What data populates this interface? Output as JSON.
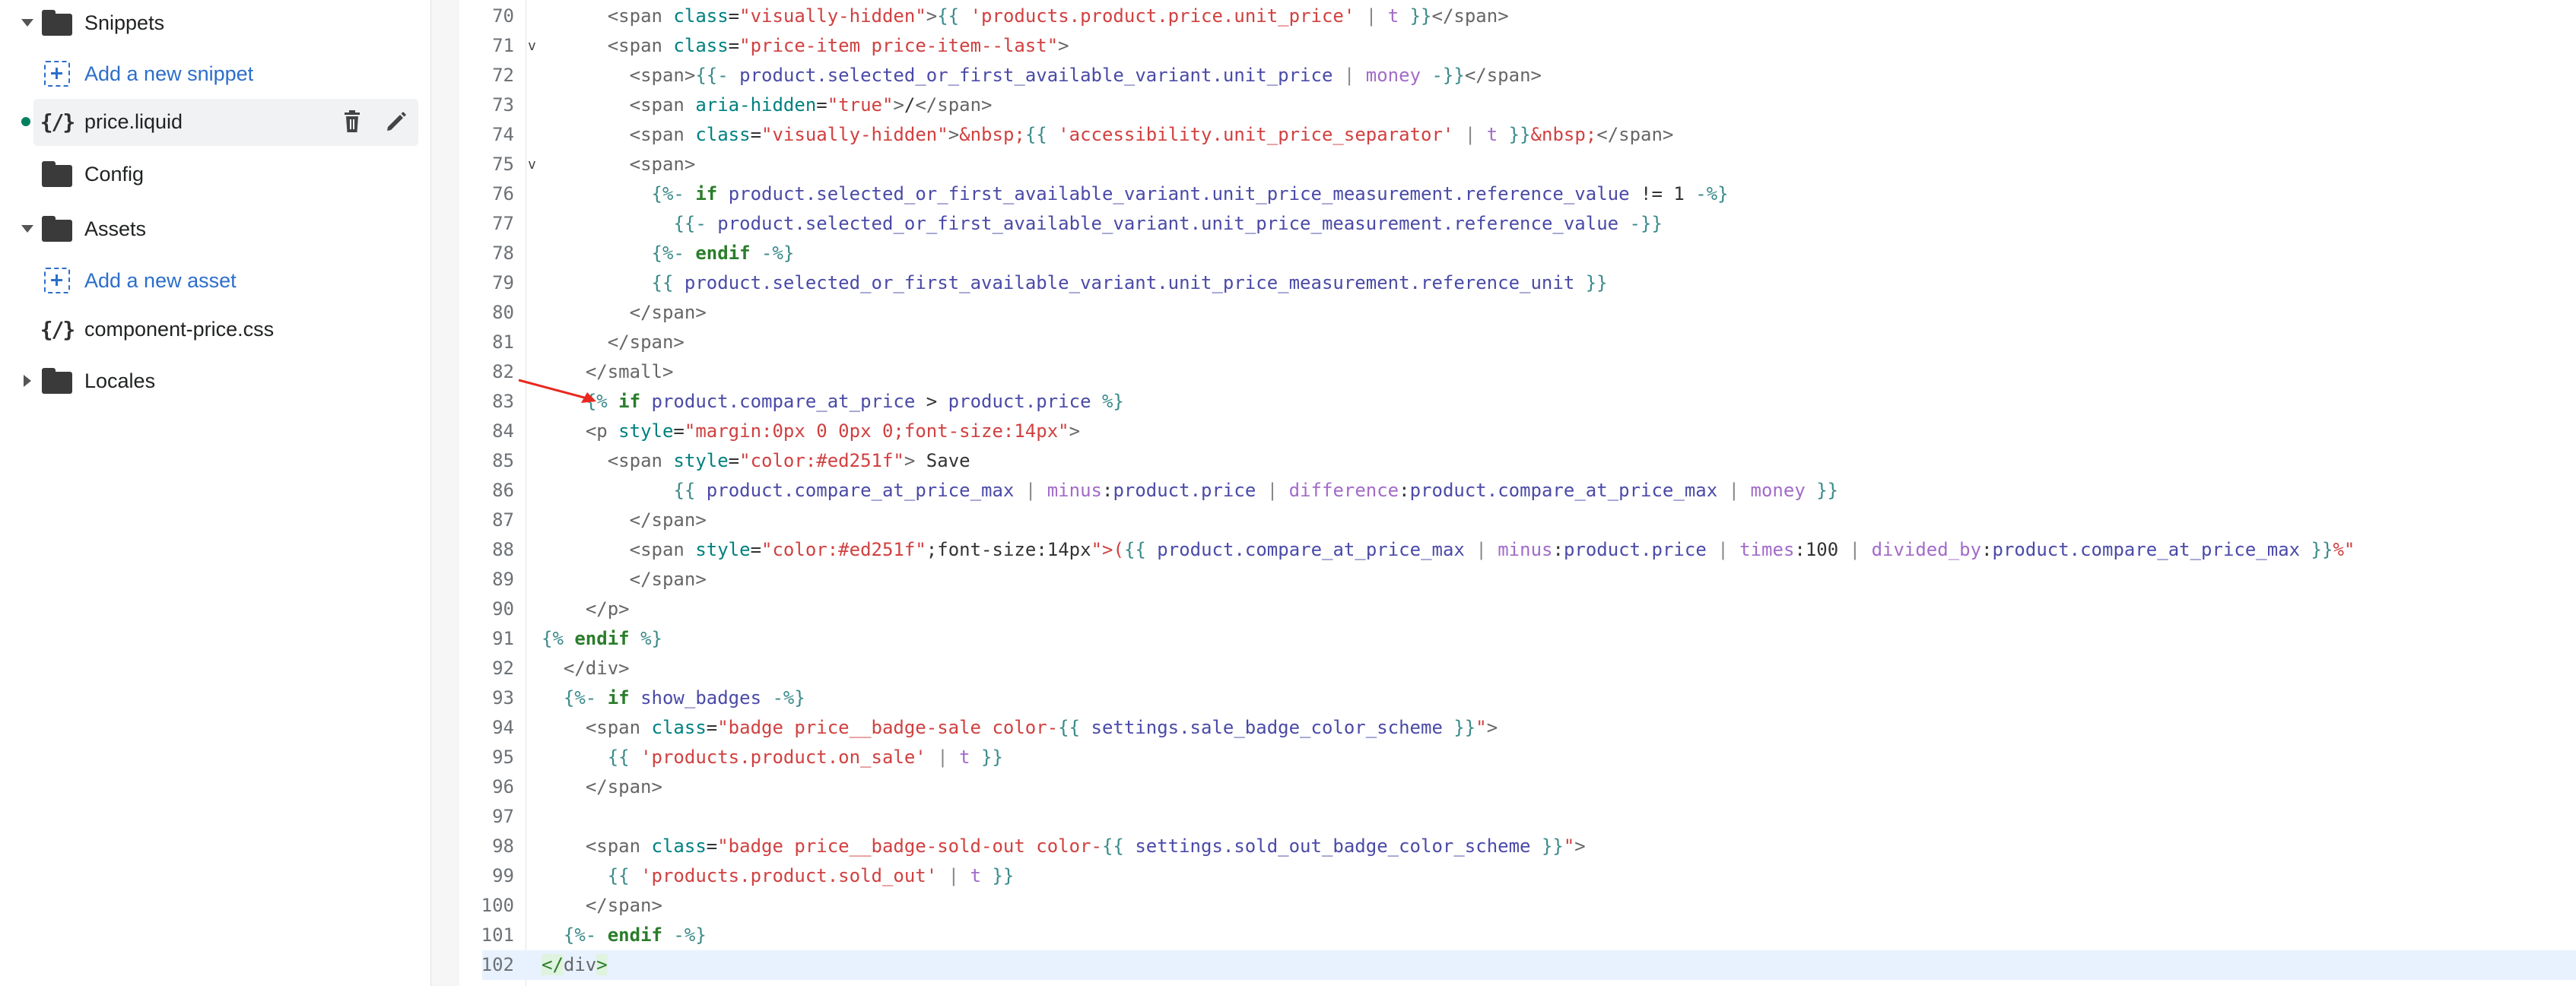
{
  "sidebar": {
    "items": [
      {
        "label": "Snippets",
        "type": "folder",
        "expanded": true
      },
      {
        "label": "Add a new snippet",
        "type": "add"
      },
      {
        "label": "price.liquid",
        "type": "file",
        "selected": true,
        "modified": true
      },
      {
        "label": "Config",
        "type": "folder"
      },
      {
        "label": "Assets",
        "type": "folder",
        "expanded": true
      },
      {
        "label": "Add a new asset",
        "type": "add"
      },
      {
        "label": "component-price.css",
        "type": "file"
      },
      {
        "label": "Locales",
        "type": "folder",
        "expanded": false
      }
    ],
    "actions": {
      "delete_icon": "trash-icon",
      "edit_icon": "pencil-icon"
    }
  },
  "editor": {
    "active_line": 102,
    "line_numbers": [
      "70",
      "71",
      "72",
      "73",
      "74",
      "75",
      "76",
      "77",
      "78",
      "79",
      "80",
      "81",
      "82",
      "83",
      "84",
      "85",
      "86",
      "87",
      "88",
      "89",
      "90",
      "91",
      "92",
      "93",
      "94",
      "95",
      "96",
      "97",
      "98",
      "99",
      "100",
      "101",
      "102"
    ],
    "folds": {
      "71": "v",
      "75": "v"
    },
    "lines": [
      "      <span class=\"visually-hidden\">{{ 'products.product.price.unit_price' | t }}</span>",
      "      <span class=\"price-item price-item--last\">",
      "        <span>{{- product.selected_or_first_available_variant.unit_price | money -}}</span>",
      "        <span aria-hidden=\"true\">/</span>",
      "        <span class=\"visually-hidden\">&nbsp;{{ 'accessibility.unit_price_separator' | t }}&nbsp;</span>",
      "        <span>",
      "          {%- if product.selected_or_first_available_variant.unit_price_measurement.reference_value != 1 -%}",
      "            {{- product.selected_or_first_available_variant.unit_price_measurement.reference_value -}}",
      "          {%- endif -%}",
      "          {{ product.selected_or_first_available_variant.unit_price_measurement.reference_unit }}",
      "        </span>",
      "      </span>",
      "    </small>",
      "    {% if product.compare_at_price > product.price %}",
      "    <p style=\"margin:0px 0 0px 0;font-size:14px\">",
      "      <span style=\"color:#ed251f\"> Save",
      "            {{ product.compare_at_price_max | minus:product.price | difference:product.compare_at_price_max | money }}",
      "        </span>",
      "        <span style=\"color:#ed251f\";font-size:14px\">({{ product.compare_at_price_max | minus:product.price | times:100 | divided_by:product.compare_at_price_max }}%)",
      "        </span>",
      "    </p>",
      "{% endif %}",
      "  </div>",
      "  {%- if show_badges -%}",
      "    <span class=\"badge price__badge-sale color-{{ settings.sale_badge_color_scheme }}\">",
      "      {{ 'products.product.on_sale' | t }}",
      "    </span>",
      "",
      "    <span class=\"badge price__badge-sold-out color-{{ settings.sold_out_badge_color_scheme }}\">",
      "      {{ 'products.product.sold_out' | t }}",
      "    </span>",
      "  {%- endif -%}",
      "</div>"
    ]
  },
  "annotation": {
    "arrow_color": "#e8281f",
    "points_to_line": 83
  }
}
